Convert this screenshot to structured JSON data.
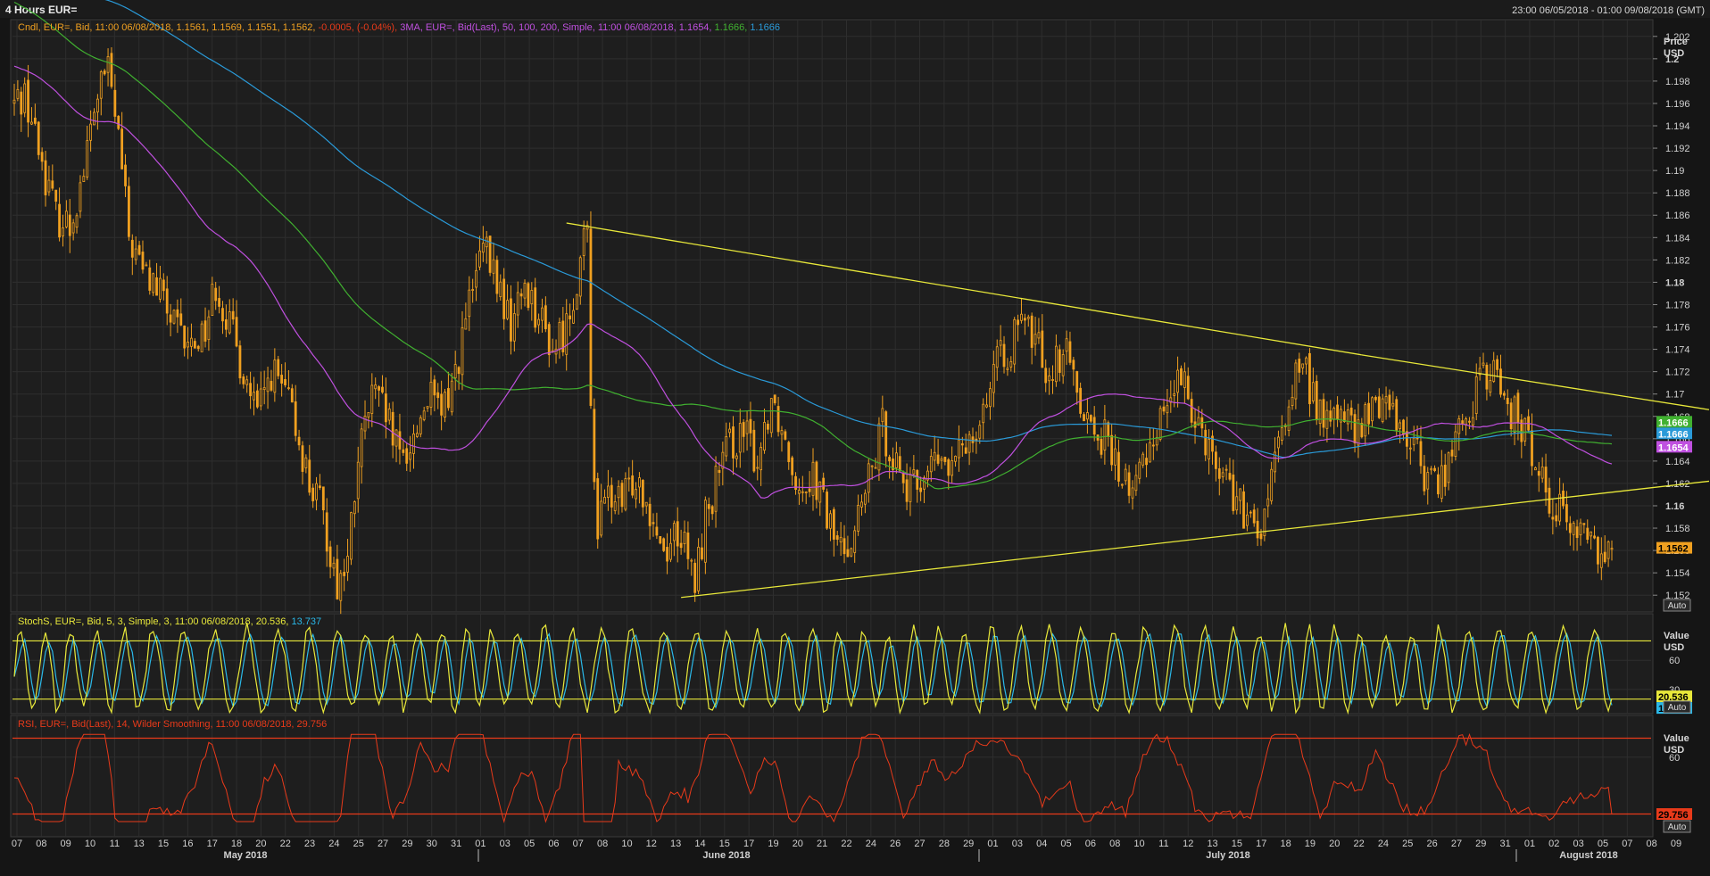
{
  "window": {
    "title": "4 Hours EUR=",
    "range": "23:00 06/05/2018 - 01:00 09/08/2018 (GMT)"
  },
  "colors": {
    "background": "#1e1e1e",
    "grid": "#2e2e2e",
    "candle": "#f0a020",
    "ma50": "#c050e0",
    "ma100": "#40b030",
    "ma200": "#2a9ad8",
    "trendline": "#e8e83a",
    "stoch_k": "#e8e83a",
    "stoch_d": "#2ab8e8",
    "rsi": "#e83a1a",
    "axis_text": "#d0d0d0"
  },
  "panels": {
    "price": {
      "legend": {
        "candle": "Cndl, EUR=, Bid, 11:00 06/08/2018, 1.1561, 1.1569, 1.1551, 1.1562,",
        "change": "-0.0005, (-0.04%),",
        "ma": "3MA, EUR=, Bid(Last), 50, 100, 200, Simple, 11:00 06/08/2018,",
        "ma50_val": "1.1654,",
        "ma100_val": "1.1666,",
        "ma200_val": "1.1666"
      },
      "axis_title": [
        "Price",
        "USD"
      ],
      "auto_label": "Auto",
      "last_labels": {
        "ma100": "1.1666",
        "ma200": "1.1666",
        "ma50": "1.1654",
        "close": "1.1562"
      }
    },
    "stoch": {
      "legend_a": "StochS, EUR=, Bid,  5, 3, Simple, 3, 11:00 06/08/2018, 20.536,",
      "legend_b": "13.737",
      "axis_title": [
        "Value",
        "USD"
      ],
      "auto_label": "Auto",
      "last_labels": {
        "k": "20.536",
        "d": "13.737"
      }
    },
    "rsi": {
      "legend": "RSI, EUR=, Bid(Last),  14, Wilder Smoothing, 11:00 06/08/2018, 29.756",
      "axis_title": [
        "Value",
        "USD"
      ],
      "auto_label": "Auto",
      "last_label": "29.756"
    }
  },
  "chart_data": {
    "type": "candlestick",
    "price_ylim": [
      1.1505,
      1.2035
    ],
    "price_ticks": [
      "1.152",
      "1.154",
      "1.156",
      "1.158",
      "1.16",
      "1.162",
      "1.164",
      "1.166",
      "1.168",
      "1.17",
      "1.172",
      "1.174",
      "1.176",
      "1.178",
      "1.18",
      "1.182",
      "1.184",
      "1.186",
      "1.188",
      "1.19",
      "1.192",
      "1.194",
      "1.196",
      "1.198",
      "1.2",
      "1.202"
    ],
    "price_ticks_bold": [
      "1.16",
      "1.18",
      "1.2"
    ],
    "stoch_ylim": [
      5,
      108
    ],
    "stoch_ticks": [
      "30",
      "60"
    ],
    "stoch_levels": [
      20,
      80
    ],
    "rsi_ylim": [
      18,
      82
    ],
    "rsi_ticks": [
      "60"
    ],
    "rsi_levels": [
      30,
      70
    ],
    "day_labels": [
      "07",
      "08",
      "09",
      "10",
      "11",
      "13",
      "15",
      "16",
      "17",
      "18",
      "20",
      "22",
      "23",
      "24",
      "25",
      "27",
      "29",
      "30",
      "31",
      "01",
      "03",
      "05",
      "06",
      "07",
      "08",
      "10",
      "12",
      "13",
      "14",
      "15",
      "17",
      "19",
      "20",
      "21",
      "22",
      "24",
      "26",
      "27",
      "28",
      "29",
      "01",
      "03",
      "04",
      "05",
      "06",
      "08",
      "10",
      "11",
      "12",
      "13",
      "15",
      "17",
      "18",
      "19",
      "20",
      "22",
      "24",
      "25",
      "26",
      "27",
      "29",
      "31",
      "01",
      "02",
      "03",
      "05",
      "07",
      "08",
      "09"
    ],
    "month_labels": [
      "May 2018",
      "June 2018",
      "July 2018",
      "August 2018"
    ],
    "close_anchors": [
      [
        0,
        1.196
      ],
      [
        3,
        1.197
      ],
      [
        7,
        1.192
      ],
      [
        12,
        1.186
      ],
      [
        16,
        1.185
      ],
      [
        20,
        1.19
      ],
      [
        24,
        1.197
      ],
      [
        27,
        1.199
      ],
      [
        30,
        1.193
      ],
      [
        33,
        1.184
      ],
      [
        37,
        1.181
      ],
      [
        42,
        1.179
      ],
      [
        46,
        1.176
      ],
      [
        50,
        1.174
      ],
      [
        55,
        1.176
      ],
      [
        58,
        1.18
      ],
      [
        62,
        1.176
      ],
      [
        66,
        1.172
      ],
      [
        70,
        1.168
      ],
      [
        74,
        1.172
      ],
      [
        78,
        1.17
      ],
      [
        82,
        1.166
      ],
      [
        85,
        1.162
      ],
      [
        88,
        1.16
      ],
      [
        91,
        1.156
      ],
      [
        93,
        1.153
      ],
      [
        96,
        1.155
      ],
      [
        99,
        1.164
      ],
      [
        103,
        1.17
      ],
      [
        107,
        1.168
      ],
      [
        111,
        1.164
      ],
      [
        115,
        1.166
      ],
      [
        119,
        1.17
      ],
      [
        123,
        1.168
      ],
      [
        127,
        1.172
      ],
      [
        131,
        1.178
      ],
      [
        135,
        1.183
      ],
      [
        139,
        1.18
      ],
      [
        143,
        1.176
      ],
      [
        147,
        1.18
      ],
      [
        151,
        1.177
      ],
      [
        155,
        1.174
      ],
      [
        159,
        1.176
      ],
      [
        163,
        1.182
      ],
      [
        165,
        1.184
      ],
      [
        166,
        1.169
      ],
      [
        168,
        1.158
      ],
      [
        171,
        1.161
      ],
      [
        175,
        1.16
      ],
      [
        179,
        1.163
      ],
      [
        183,
        1.16
      ],
      [
        187,
        1.156
      ],
      [
        191,
        1.158
      ],
      [
        194,
        1.155
      ],
      [
        196,
        1.153
      ],
      [
        199,
        1.159
      ],
      [
        203,
        1.163
      ],
      [
        207,
        1.166
      ],
      [
        211,
        1.166
      ],
      [
        214,
        1.164
      ],
      [
        218,
        1.17
      ],
      [
        222,
        1.166
      ],
      [
        226,
        1.162
      ],
      [
        230,
        1.163
      ],
      [
        234,
        1.159
      ],
      [
        238,
        1.156
      ],
      [
        242,
        1.158
      ],
      [
        246,
        1.162
      ],
      [
        250,
        1.167
      ],
      [
        254,
        1.164
      ],
      [
        258,
        1.161
      ],
      [
        262,
        1.163
      ],
      [
        266,
        1.164
      ],
      [
        270,
        1.163
      ],
      [
        274,
        1.166
      ],
      [
        278,
        1.168
      ],
      [
        282,
        1.172
      ],
      [
        286,
        1.174
      ],
      [
        290,
        1.176
      ],
      [
        294,
        1.175
      ],
      [
        298,
        1.172
      ],
      [
        302,
        1.174
      ],
      [
        306,
        1.171
      ],
      [
        310,
        1.167
      ],
      [
        314,
        1.166
      ],
      [
        318,
        1.163
      ],
      [
        322,
        1.161
      ],
      [
        326,
        1.165
      ],
      [
        330,
        1.168
      ],
      [
        334,
        1.171
      ],
      [
        338,
        1.17
      ],
      [
        342,
        1.167
      ],
      [
        346,
        1.164
      ],
      [
        350,
        1.162
      ],
      [
        354,
        1.159
      ],
      [
        358,
        1.157
      ],
      [
        362,
        1.162
      ],
      [
        366,
        1.168
      ],
      [
        370,
        1.173
      ],
      [
        374,
        1.17
      ],
      [
        378,
        1.167
      ],
      [
        382,
        1.169
      ],
      [
        386,
        1.166
      ],
      [
        390,
        1.168
      ],
      [
        394,
        1.17
      ],
      [
        398,
        1.168
      ],
      [
        402,
        1.166
      ],
      [
        406,
        1.163
      ],
      [
        410,
        1.162
      ],
      [
        414,
        1.165
      ],
      [
        418,
        1.168
      ],
      [
        422,
        1.171
      ],
      [
        426,
        1.172
      ],
      [
        430,
        1.169
      ],
      [
        434,
        1.167
      ],
      [
        438,
        1.164
      ],
      [
        442,
        1.161
      ],
      [
        446,
        1.159
      ],
      [
        450,
        1.158
      ],
      [
        454,
        1.157
      ],
      [
        458,
        1.156
      ],
      [
        460,
        1.156
      ]
    ],
    "ma_start": {
      "ma50": 1.2025,
      "ma100": 1.214,
      "ma200": 1.222
    }
  }
}
